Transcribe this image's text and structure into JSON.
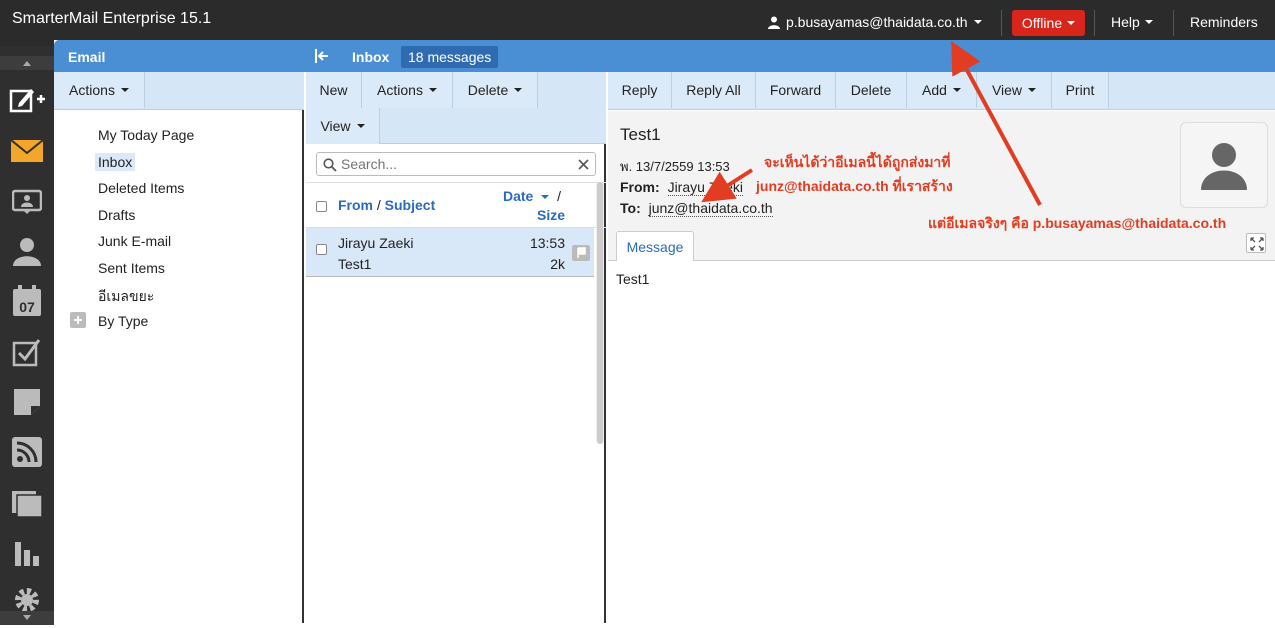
{
  "app": {
    "title": "SmarterMail Enterprise 15.1"
  },
  "top": {
    "user": "p.busayamas@thaidata.co.th",
    "status": "Offline",
    "help": "Help",
    "reminders": "Reminders"
  },
  "folders": {
    "header": "Email",
    "actions": "Actions",
    "items": [
      "My Today Page",
      "Inbox",
      "Deleted Items",
      "Drafts",
      "Junk E-mail",
      "Sent Items",
      "อีเมลขยะ",
      "By Type"
    ]
  },
  "list": {
    "header": "Inbox",
    "count": "18 messages",
    "toolbar": {
      "new": "New",
      "actions": "Actions",
      "delete": "Delete",
      "view": "View"
    },
    "search_placeholder": "Search...",
    "columns": {
      "from": "From",
      "subject": "Subject",
      "date": "Date",
      "size": "Size",
      "slash": "/"
    },
    "rows": [
      {
        "from": "Jirayu Zaeki",
        "subject": "Test1",
        "time": "13:53",
        "size": "2k"
      }
    ]
  },
  "reader": {
    "toolbar": {
      "reply": "Reply",
      "reply_all": "Reply All",
      "forward": "Forward",
      "delete": "Delete",
      "add": "Add",
      "view": "View",
      "print": "Print"
    },
    "subject": "Test1",
    "date": "พ. 13/7/2559 13:53",
    "from_label": "From:",
    "from": "Jirayu Zaeki",
    "to_label": "To:",
    "to": "junz@thaidata.co.th",
    "tab": "Message",
    "body": "Test1"
  },
  "annotations": {
    "line1": "จะเห็นได้ว่าอีเมลนี้ได้ถูกส่งมาที่",
    "line2": "junz@thaidata.co.th ที่เราสร้าง",
    "line3": "แต่อีเมลจริงๆ คือ p.busayamas@thaidata.co.th"
  },
  "colors": {
    "accent": "#4a8ed4",
    "toolbar": "#d5e7f7",
    "offline": "#d9261c",
    "annotation": "#e23d22"
  }
}
